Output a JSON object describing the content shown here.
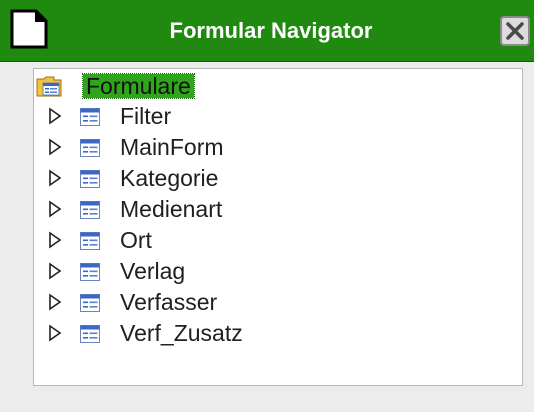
{
  "window": {
    "title": "Formular Navigator"
  },
  "tree": {
    "root": {
      "label": "Formulare",
      "icon": "forms-folder-icon",
      "selected": true
    },
    "items": [
      {
        "label": "Filter",
        "icon": "form-icon"
      },
      {
        "label": "MainForm",
        "icon": "form-icon"
      },
      {
        "label": "Kategorie",
        "icon": "form-icon"
      },
      {
        "label": "Medienart",
        "icon": "form-icon"
      },
      {
        "label": "Ort",
        "icon": "form-icon"
      },
      {
        "label": "Verlag",
        "icon": "form-icon"
      },
      {
        "label": "Verfasser",
        "icon": "form-icon"
      },
      {
        "label": "Verf_Zusatz",
        "icon": "form-icon"
      }
    ]
  },
  "colors": {
    "titlebar": "#1f8a0f",
    "selection": "#2fa51c"
  }
}
